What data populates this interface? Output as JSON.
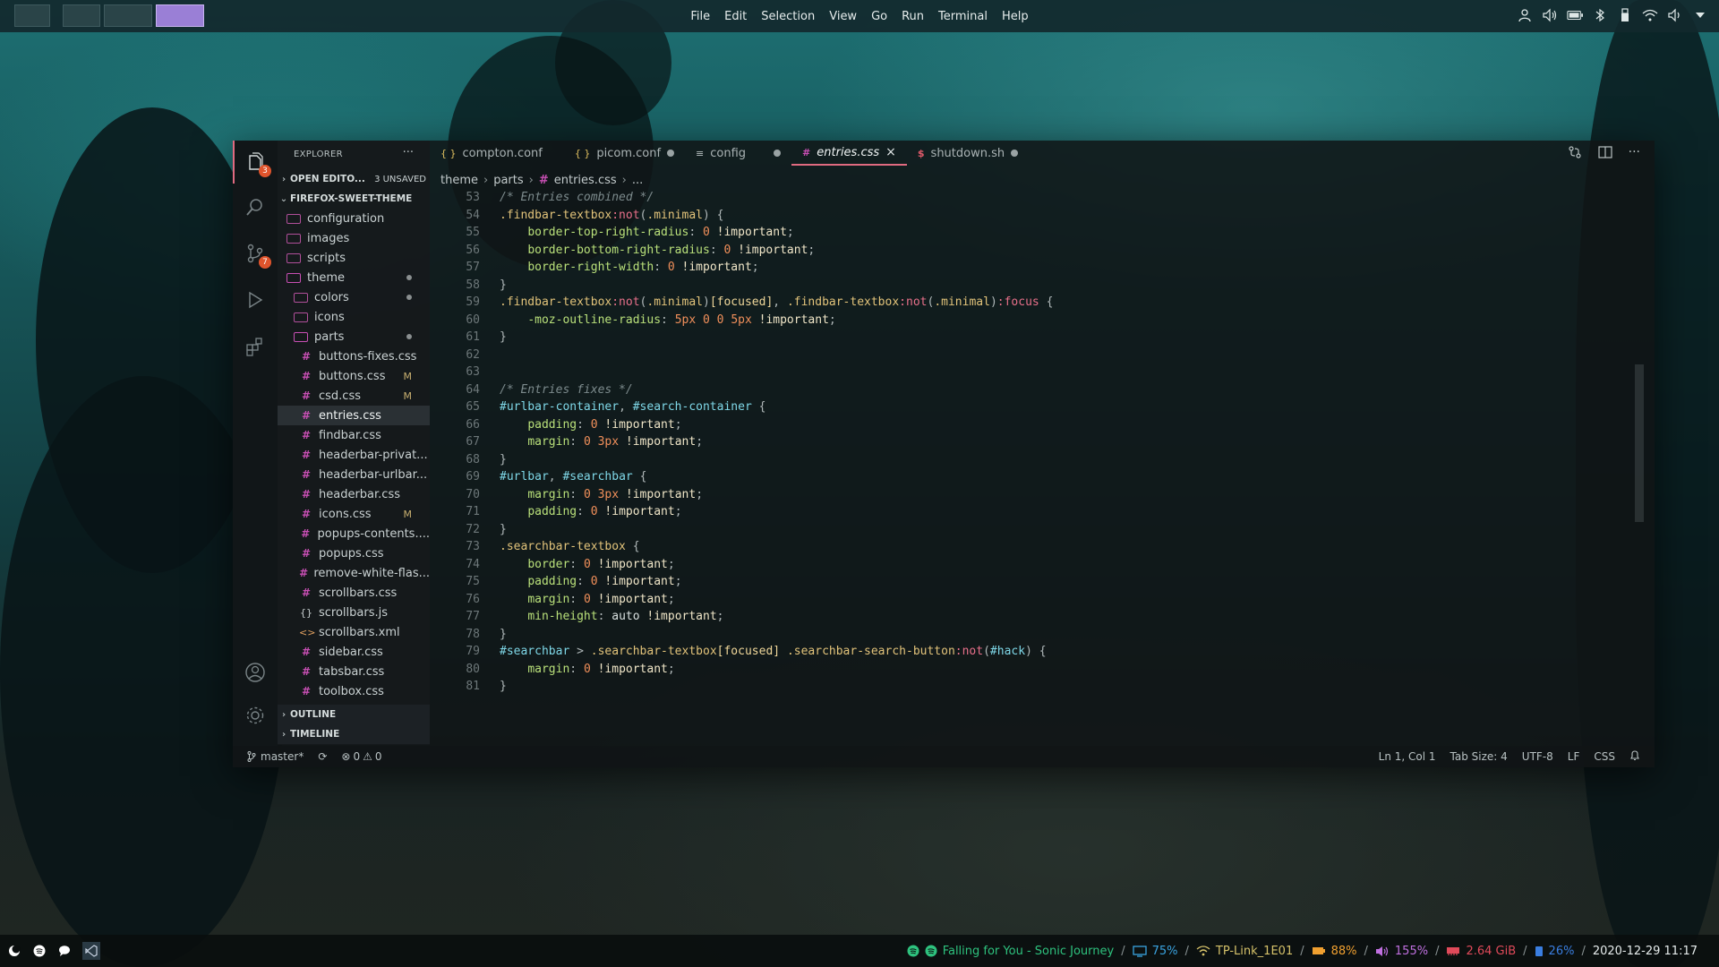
{
  "menu": [
    "File",
    "Edit",
    "Selection",
    "View",
    "Go",
    "Run",
    "Terminal",
    "Help"
  ],
  "tray_icons": [
    "user-icon",
    "volume-icon",
    "battery-icon",
    "bluetooth-icon",
    "usb-icon",
    "wifi-icon",
    "speaker-icon",
    "chevron-down-icon"
  ],
  "activity": {
    "explorer_badge": "3",
    "scm_badge": "7"
  },
  "sidebar": {
    "title": "EXPLORER",
    "more": "···",
    "open_editors": "OPEN EDITO...",
    "unsaved": "3 UNSAVED",
    "project": "FIREFOX-SWEET-THEME",
    "folders": [
      "configuration",
      "images",
      "scripts",
      "theme"
    ],
    "theme_children": [
      "colors",
      "icons",
      "parts"
    ],
    "files": [
      {
        "name": "buttons-fixes.css",
        "type": "css",
        "git": ""
      },
      {
        "name": "buttons.css",
        "type": "css",
        "git": "M"
      },
      {
        "name": "csd.css",
        "type": "css",
        "git": "M"
      },
      {
        "name": "entries.css",
        "type": "css",
        "git": ""
      },
      {
        "name": "findbar.css",
        "type": "css",
        "git": ""
      },
      {
        "name": "headerbar-privat...",
        "type": "css",
        "git": ""
      },
      {
        "name": "headerbar-urlbar...",
        "type": "css",
        "git": ""
      },
      {
        "name": "headerbar.css",
        "type": "css",
        "git": ""
      },
      {
        "name": "icons.css",
        "type": "css",
        "git": "M"
      },
      {
        "name": "popups-contents....",
        "type": "css",
        "git": ""
      },
      {
        "name": "popups.css",
        "type": "css",
        "git": ""
      },
      {
        "name": "remove-white-flas...",
        "type": "css",
        "git": ""
      },
      {
        "name": "scrollbars.css",
        "type": "css",
        "git": ""
      },
      {
        "name": "scrollbars.js",
        "type": "js",
        "git": ""
      },
      {
        "name": "scrollbars.xml",
        "type": "xml",
        "git": ""
      },
      {
        "name": "sidebar.css",
        "type": "css",
        "git": ""
      },
      {
        "name": "tabsbar.css",
        "type": "css",
        "git": ""
      },
      {
        "name": "toolbox.css",
        "type": "css",
        "git": ""
      }
    ],
    "outline": "OUTLINE",
    "timeline": "TIMELINE"
  },
  "tabs": [
    {
      "label": "compton.conf",
      "icon": "{ }",
      "dirty": false,
      "active": false
    },
    {
      "label": "picom.conf",
      "icon": "{ }",
      "dirty": true,
      "active": false
    },
    {
      "label": "config",
      "icon": "≡",
      "dirty": true,
      "active": false
    },
    {
      "label": "entries.css",
      "icon": "#",
      "dirty": false,
      "active": true
    },
    {
      "label": "shutdown.sh",
      "icon": "$",
      "dirty": true,
      "active": false
    }
  ],
  "breadcrumb": [
    "theme",
    "parts",
    "entries.css",
    "..."
  ],
  "code": {
    "lines": [
      {
        "n": "53",
        "t": "/* Entries combined */"
      },
      {
        "n": "54",
        "t": ".findbar-textbox:not(.minimal) {"
      },
      {
        "n": "55",
        "t": "    border-top-right-radius: 0 !important;"
      },
      {
        "n": "56",
        "t": "    border-bottom-right-radius: 0 !important;"
      },
      {
        "n": "57",
        "t": "    border-right-width: 0 !important;"
      },
      {
        "n": "58",
        "t": "}"
      },
      {
        "n": "59",
        "t": ".findbar-textbox:not(.minimal)[focused], .findbar-textbox:not(.minimal):focus {"
      },
      {
        "n": "60",
        "t": "    -moz-outline-radius: 5px 0 0 5px !important;"
      },
      {
        "n": "61",
        "t": "}"
      },
      {
        "n": "62",
        "t": ""
      },
      {
        "n": "63",
        "t": ""
      },
      {
        "n": "64",
        "t": "/* Entries fixes */"
      },
      {
        "n": "65",
        "t": "#urlbar-container, #search-container {"
      },
      {
        "n": "66",
        "t": "    padding: 0 !important;"
      },
      {
        "n": "67",
        "t": "    margin: 0 3px !important;"
      },
      {
        "n": "68",
        "t": "}"
      },
      {
        "n": "69",
        "t": "#urlbar, #searchbar {"
      },
      {
        "n": "70",
        "t": "    margin: 0 3px !important;"
      },
      {
        "n": "71",
        "t": "    padding: 0 !important;"
      },
      {
        "n": "72",
        "t": "}"
      },
      {
        "n": "73",
        "t": ".searchbar-textbox {"
      },
      {
        "n": "74",
        "t": "    border: 0 !important;"
      },
      {
        "n": "75",
        "t": "    padding: 0 !important;"
      },
      {
        "n": "76",
        "t": "    margin: 0 !important;"
      },
      {
        "n": "77",
        "t": "    min-height: auto !important;"
      },
      {
        "n": "78",
        "t": "}"
      },
      {
        "n": "79",
        "t": "#searchbar > .searchbar-textbox[focused] .searchbar-search-button:not(#hack) {"
      },
      {
        "n": "80",
        "t": "    margin: 0 !important;"
      },
      {
        "n": "81",
        "t": "}"
      }
    ]
  },
  "status": {
    "branch": "master*",
    "errors": "0",
    "warnings": "0",
    "position": "Ln 1, Col 1",
    "tab_size": "Tab Size: 4",
    "encoding": "UTF-8",
    "eol": "LF",
    "language": "CSS"
  },
  "bottom": {
    "song": "Falling for You - Sonic Journey",
    "brightness": "75%",
    "wifi": "TP-Link_1E01",
    "battery": "88%",
    "volume": "155%",
    "memory": "2.64 GiB",
    "disk": "26%",
    "datetime": "2020-12-29 11:17"
  },
  "colors": {
    "accent": "#e06a80",
    "song_color": "#2ec27e",
    "brightness_color": "#3aa3e0",
    "wifi_color": "#d6c26a",
    "battery_color": "#f0a030",
    "volume_color": "#c070e0",
    "memory_color": "#e04a5a",
    "disk_color": "#3a7ee0"
  }
}
